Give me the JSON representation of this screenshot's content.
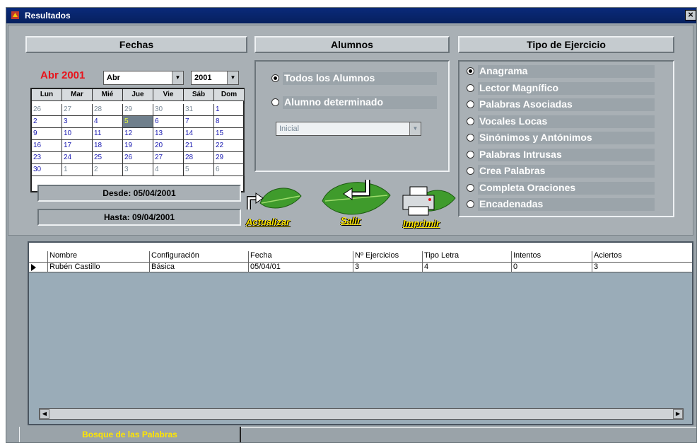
{
  "window": {
    "title": "Resultados",
    "close_label": "×"
  },
  "fechas": {
    "header": "Fechas",
    "month_label": "Abr 2001",
    "month_select": "Abr",
    "year_select": "2001",
    "weekdays": [
      "Lun",
      "Mar",
      "Mié",
      "Jue",
      "Vie",
      "Sáb",
      "Dom"
    ],
    "weeks": [
      [
        "26",
        "27",
        "28",
        "29",
        "30",
        "31",
        "1"
      ],
      [
        "2",
        "3",
        "4",
        "5",
        "6",
        "7",
        "8"
      ],
      [
        "9",
        "10",
        "11",
        "12",
        "13",
        "14",
        "15"
      ],
      [
        "16",
        "17",
        "18",
        "19",
        "20",
        "21",
        "22"
      ],
      [
        "23",
        "24",
        "25",
        "26",
        "27",
        "28",
        "29"
      ],
      [
        "30",
        "1",
        "2",
        "3",
        "4",
        "5",
        "6"
      ]
    ],
    "selected_day": "5",
    "desde": "Desde: 05/04/2001",
    "hasta": "Hasta: 09/04/2001"
  },
  "alumnos": {
    "header": "Alumnos",
    "options": [
      {
        "label": "Todos los Alumnos",
        "selected": true
      },
      {
        "label": "Alumno determinado",
        "selected": false
      }
    ],
    "select_value": "Inicial"
  },
  "tipo_ejercicio": {
    "header": "Tipo de Ejercicio",
    "options": [
      {
        "label": "Anagrama",
        "selected": true
      },
      {
        "label": "Lector Magnífico",
        "selected": false
      },
      {
        "label": "Palabras Asociadas",
        "selected": false
      },
      {
        "label": "Vocales Locas",
        "selected": false
      },
      {
        "label": "Sinónimos y Antónimos",
        "selected": false
      },
      {
        "label": "Palabras Intrusas",
        "selected": false
      },
      {
        "label": "Crea Palabras",
        "selected": false
      },
      {
        "label": "Completa Oraciones",
        "selected": false
      },
      {
        "label": "Encadenadas",
        "selected": false
      }
    ]
  },
  "actions": {
    "actualizar": "Actualizar",
    "salir": "Salir",
    "imprimir": "Imprimir"
  },
  "grid": {
    "columns": [
      "Nombre",
      "Configuración",
      "Fecha",
      "Nº Ejercicios",
      "Tipo Letra",
      "Intentos",
      "Aciertos"
    ],
    "rows": [
      [
        "Rubén Castillo",
        "Básica",
        "05/04/01",
        "3",
        "4",
        "0",
        "3"
      ]
    ]
  },
  "tab": {
    "label": "Bosque de las Palabras"
  },
  "colors": {
    "title_bar": "#06205e",
    "month_label": "#e8141c",
    "tab_text": "#ffe600",
    "leaf_green": "#3f9b2c"
  }
}
